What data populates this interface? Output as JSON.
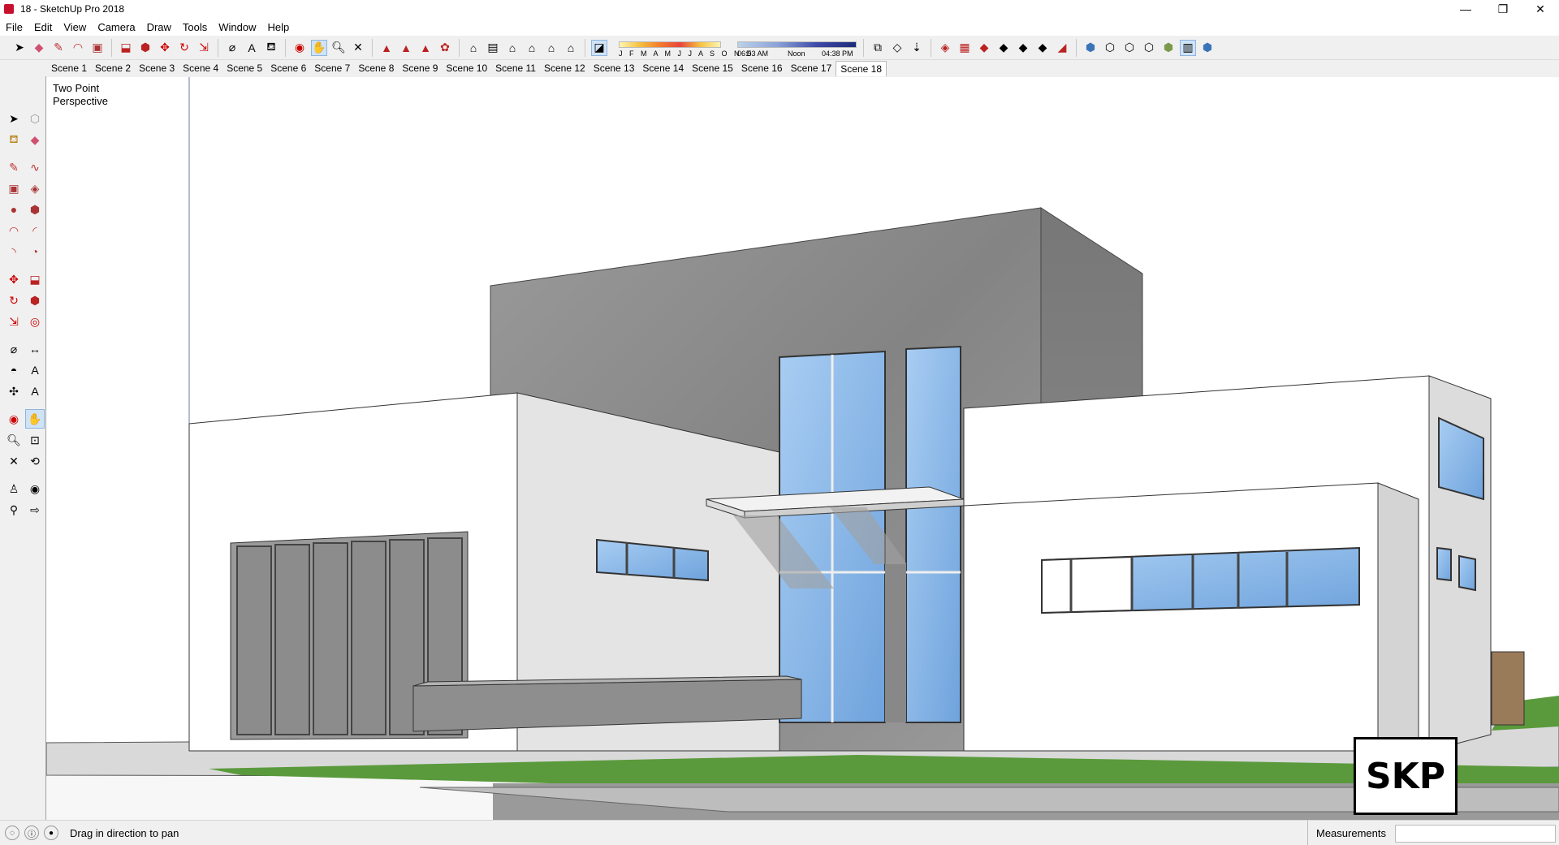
{
  "window": {
    "title": "18 - SketchUp Pro 2018",
    "minimize": "—",
    "restore": "❐",
    "close": "✕"
  },
  "menu": [
    "File",
    "Edit",
    "View",
    "Camera",
    "Draw",
    "Tools",
    "Window",
    "Help"
  ],
  "toolbar": {
    "months": "J F M A M J J A S O N D",
    "time_start": "06:53 AM",
    "time_mid": "Noon",
    "time_end": "04:38 PM"
  },
  "scenes": [
    "Scene 1",
    "Scene 2",
    "Scene 3",
    "Scene 4",
    "Scene 5",
    "Scene 6",
    "Scene 7",
    "Scene 8",
    "Scene 9",
    "Scene 10",
    "Scene 11",
    "Scene 12",
    "Scene 13",
    "Scene 14",
    "Scene 15",
    "Scene 16",
    "Scene 17",
    "Scene 18"
  ],
  "active_scene": "Scene 18",
  "viewport": {
    "camera_label_line1": "Two Point",
    "camera_label_line2": "Perspective",
    "logo_text": "SKP"
  },
  "status": {
    "message": "Drag in direction to pan",
    "measurements_label": "Measurements"
  },
  "colors": {
    "glass": "#8fbbe8",
    "concrete": "#8d8d8d",
    "lawn": "#5a9a3c",
    "wall_shadow": "#d0d0d0"
  }
}
